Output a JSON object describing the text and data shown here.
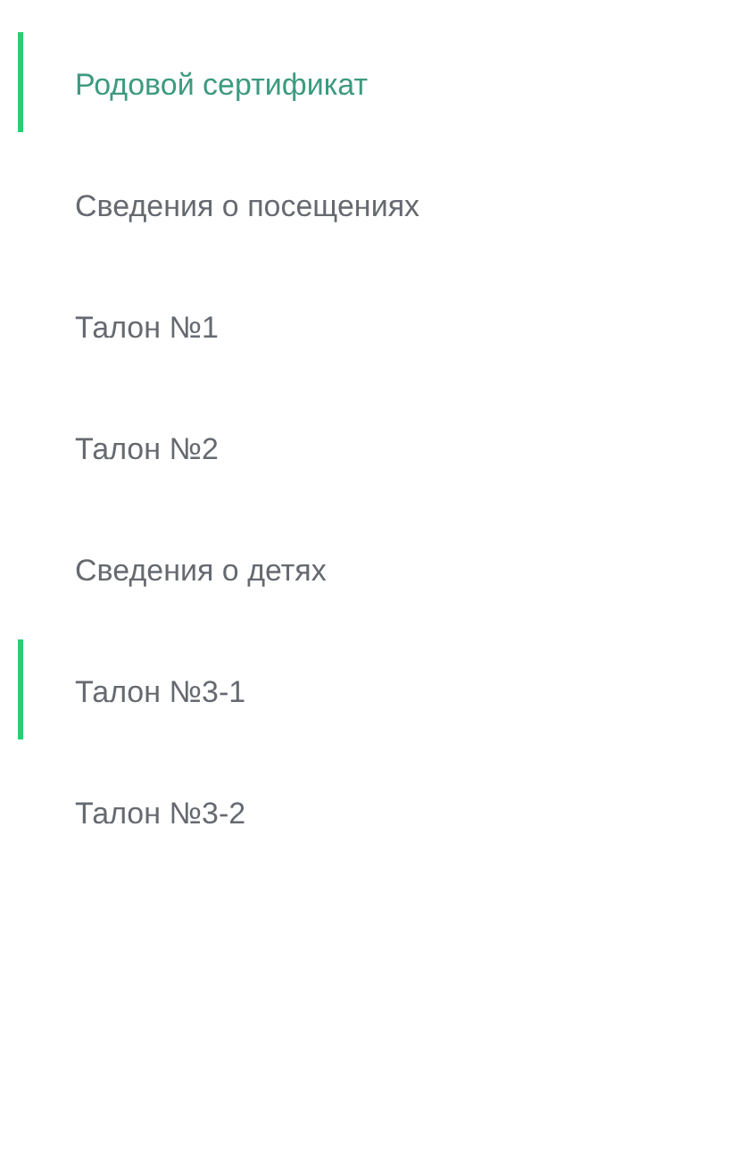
{
  "menu": {
    "items": [
      {
        "label": "Родовой сертификат",
        "selected": true,
        "highlighted": true
      },
      {
        "label": "Сведения о посещениях",
        "selected": false,
        "highlighted": false
      },
      {
        "label": "Талон №1",
        "selected": false,
        "highlighted": false
      },
      {
        "label": "Талон №2",
        "selected": false,
        "highlighted": false
      },
      {
        "label": "Сведения о детях",
        "selected": false,
        "highlighted": false
      },
      {
        "label": "Талон №3-1",
        "selected": false,
        "highlighted": true
      },
      {
        "label": "Талон №3-2",
        "selected": false,
        "highlighted": false
      }
    ]
  }
}
